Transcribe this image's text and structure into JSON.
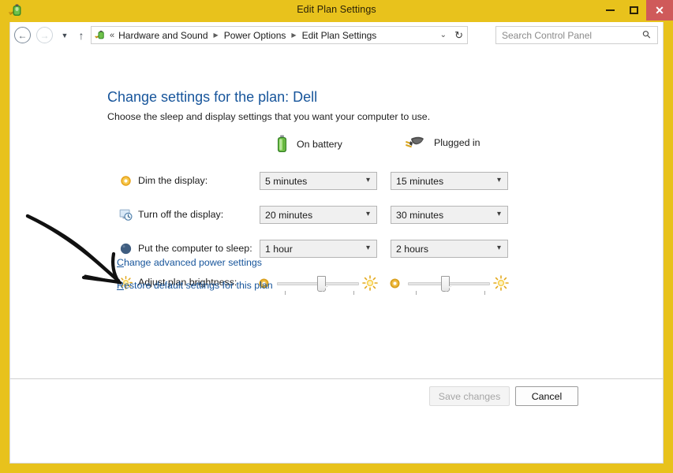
{
  "window": {
    "title": "Edit Plan Settings",
    "icon": "power-options-icon",
    "accent_color": "#e8c21c",
    "close_color": "#cf5a5a",
    "controls": {
      "minimize": "–",
      "maximize": "□",
      "close": "✕"
    }
  },
  "nav": {
    "back": "←",
    "forward": "→",
    "recent_dropdown": "▼",
    "up": "↑",
    "refresh": "↻",
    "address_dropdown": "⌄",
    "breadcrumb_prefix": "«",
    "breadcrumb_separator": "▶",
    "breadcrumbs": [
      "Hardware and Sound",
      "Power Options",
      "Edit Plan Settings"
    ]
  },
  "search": {
    "placeholder": "Search Control Panel",
    "value": "",
    "icon": "search-icon"
  },
  "page": {
    "heading": "Change settings for the plan: Dell",
    "subtext": "Choose the sleep and display settings that you want your computer to use.",
    "heading_color": "#17559b"
  },
  "columns": [
    {
      "label": "On battery",
      "icon": "battery-icon"
    },
    {
      "label": "Plugged in",
      "icon": "power-plug-icon"
    }
  ],
  "settings": [
    {
      "label": "Dim the display:",
      "icon": "dim-display-icon",
      "on_battery": "5 minutes",
      "plugged_in": "15 minutes"
    },
    {
      "label": "Turn off the display:",
      "icon": "monitor-clock-icon",
      "on_battery": "20 minutes",
      "plugged_in": "30 minutes"
    },
    {
      "label": "Put the computer to sleep:",
      "icon": "sleep-moon-icon",
      "on_battery": "1 hour",
      "plugged_in": "2 hours"
    }
  ],
  "brightness": {
    "label": "Adjust plan brightness:",
    "icon": "sun-icon",
    "low_icon": "dim-sun-icon",
    "high_icon": "bright-sun-icon",
    "on_battery_percent": 55,
    "plugged_in_percent": 45
  },
  "links": [
    {
      "accel": "C",
      "rest": "hange advanced power settings"
    },
    {
      "accel": "R",
      "rest": "estore default settings for this plan"
    }
  ],
  "footer": {
    "save_label": "Save changes",
    "save_enabled": false,
    "cancel_label": "Cancel"
  },
  "annotation": {
    "type": "hand-drawn-arrow",
    "color": "#111111",
    "points_to": "Adjust plan brightness:"
  }
}
